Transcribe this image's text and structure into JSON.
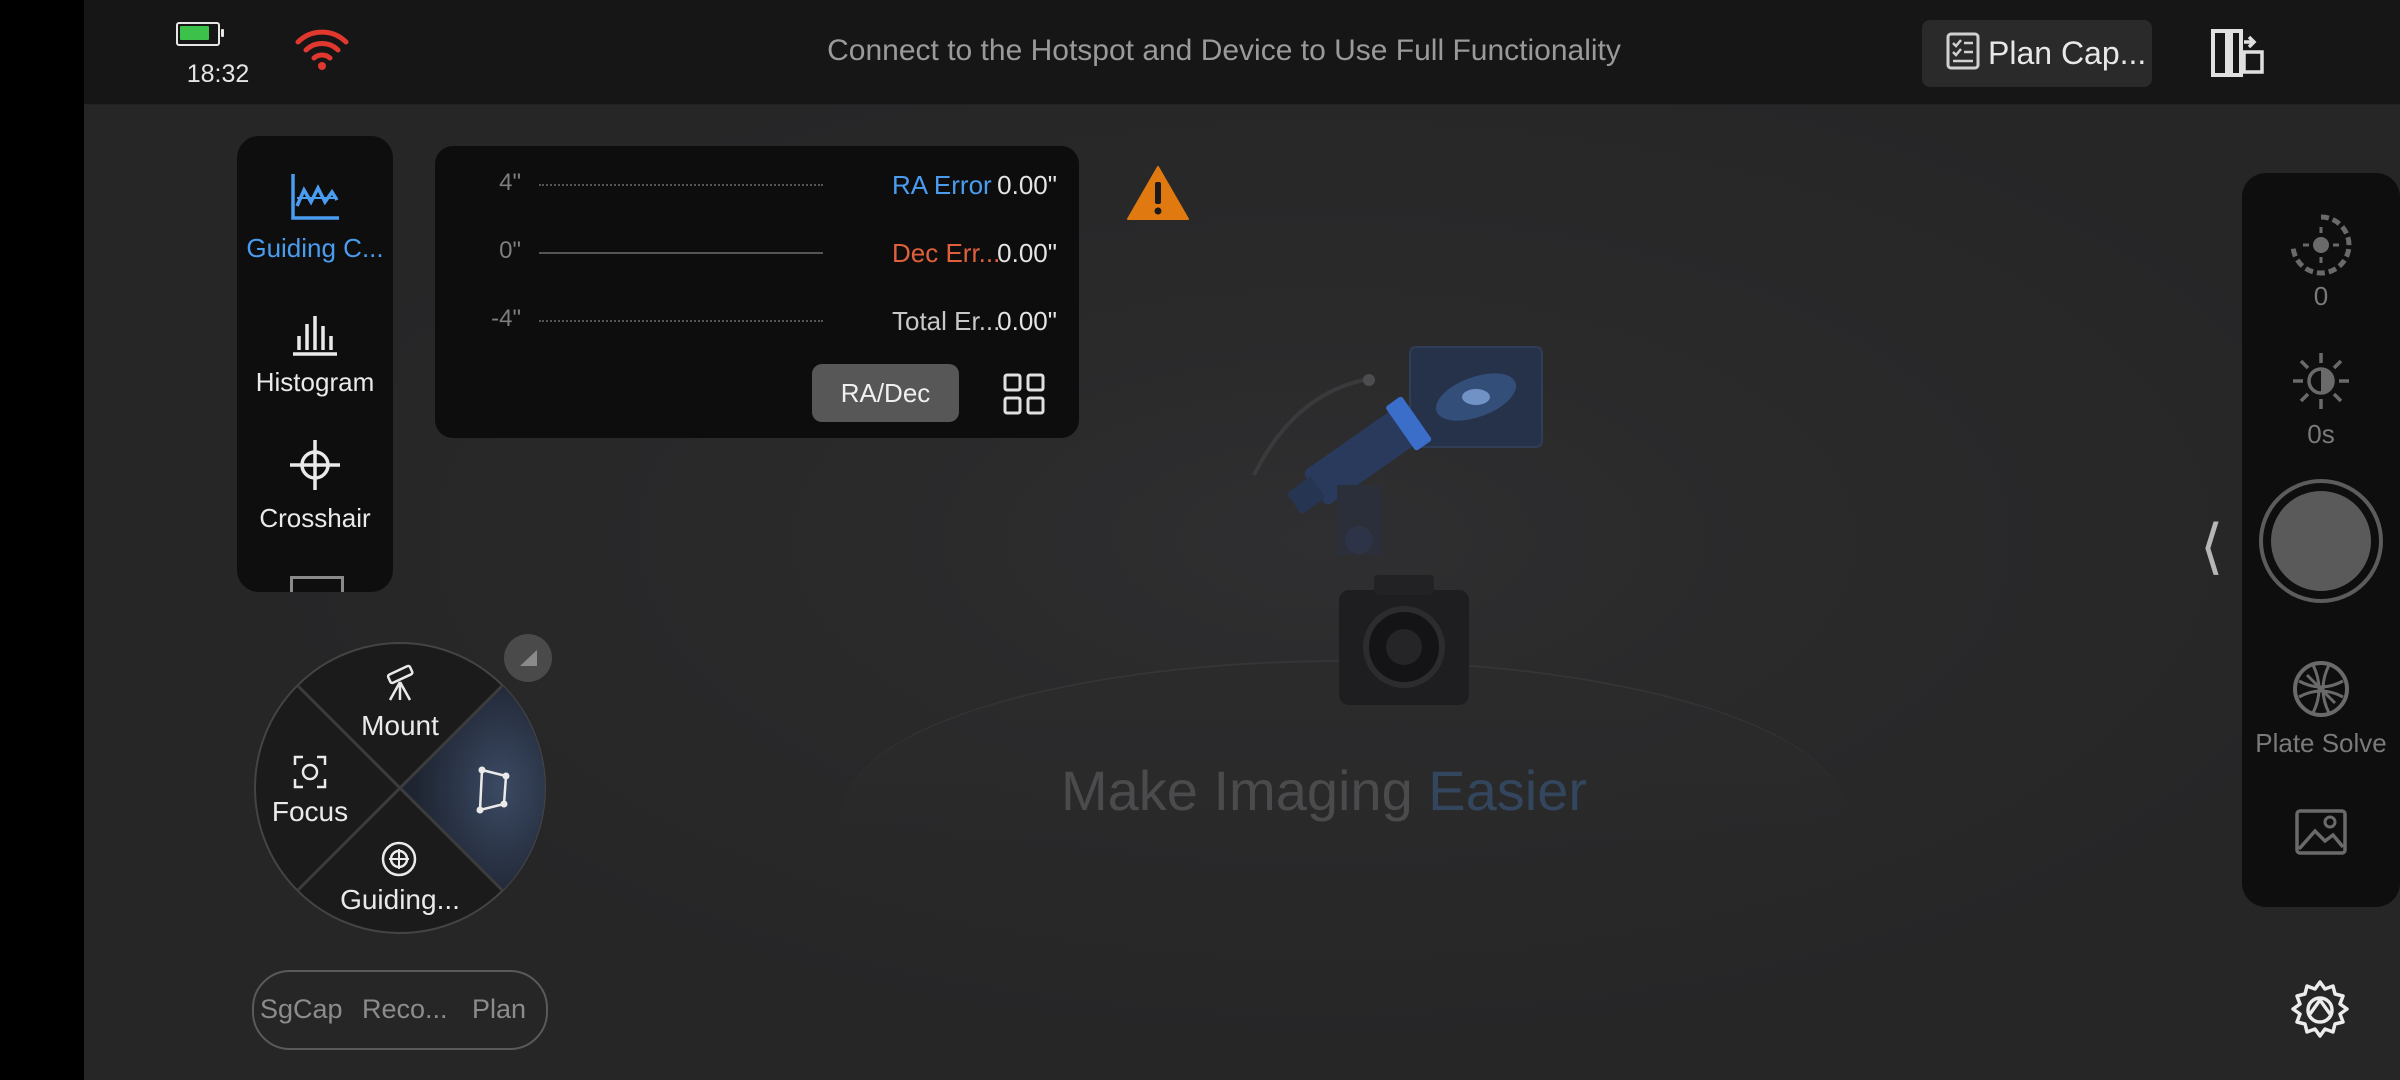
{
  "status": {
    "time": "18:32",
    "battery_level": 0.8,
    "battery_icon": "battery-icon",
    "wifi_icon": "wifi-icon",
    "wifi_color": "#e0382e"
  },
  "header": {
    "notice": "Connect to the Hotspot and Device to Use Full Functionality",
    "plan_button_label": "Plan Cap...",
    "scheme_icon": "scheme-icon"
  },
  "tools": {
    "items": [
      {
        "label": "Guiding C...",
        "icon": "guiding-chart-icon",
        "active": true
      },
      {
        "label": "Histogram",
        "icon": "histogram-icon",
        "active": false
      },
      {
        "label": "Crosshair",
        "icon": "crosshair-icon",
        "active": false
      }
    ]
  },
  "guide_chart": {
    "y_ticks": [
      "4\"",
      "0\"",
      "-4\""
    ],
    "legend": [
      {
        "name": "RA Error",
        "value": "0.00\"",
        "color": "#4a9cf0"
      },
      {
        "name": "Dec Err...",
        "value": "0.00\"",
        "color": "#e0603c"
      },
      {
        "name": "Total Er...",
        "value": "0.00\"",
        "color": "#c8c8c8"
      }
    ],
    "mode_button": "RA/Dec",
    "layout_icon": "grid-icon"
  },
  "main": {
    "warning_icon": "warning-icon",
    "warning_color": "#e07a10",
    "slogan_main": "Make Imaging ",
    "slogan_accent": "Easier",
    "illustration": "telescope-camera-illustration"
  },
  "wheel": {
    "segments": [
      {
        "label": "Mount",
        "icon": "telescope-icon"
      },
      {
        "label": "Focus",
        "icon": "focus-icon"
      },
      {
        "label": "Guiding...",
        "icon": "guiding-target-icon"
      },
      {
        "label": "",
        "icon": "constellation-icon"
      }
    ]
  },
  "mode_tabs": [
    "SgCap",
    "Reco...",
    "Plan"
  ],
  "right_panel": {
    "gain_value": "0",
    "exposure_value": "0s",
    "plate_solve_label": "Plate Solve",
    "gallery_icon": "image-icon",
    "collapse_icon": "chevron-left-icon",
    "settings_icon": "gear-icon"
  }
}
